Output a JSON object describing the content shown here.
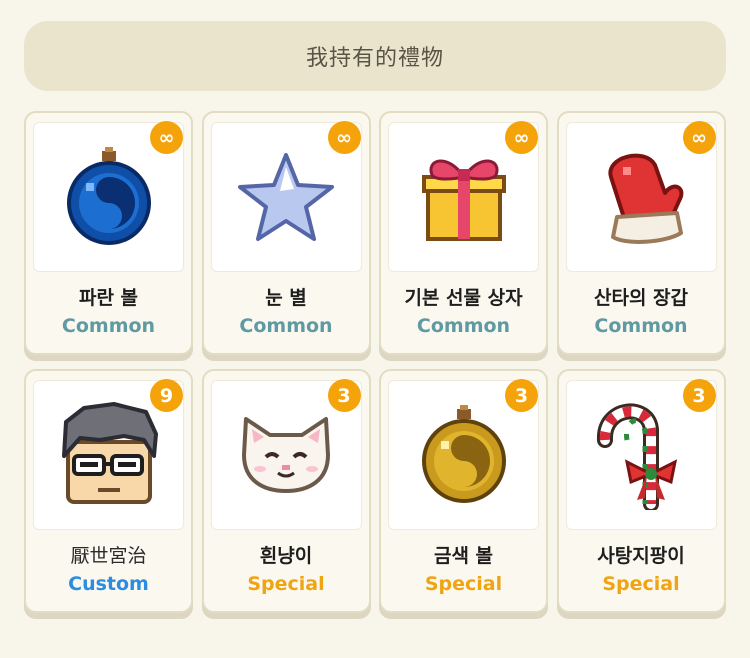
{
  "header": {
    "title": "我持有的禮物"
  },
  "colors": {
    "common": "#5f9aa3",
    "custom": "#2b8de0",
    "special": "#f0a412",
    "badge": "#f5a30a"
  },
  "items": [
    {
      "name": "파란 볼",
      "rarity": "Common",
      "rarity_class": "common",
      "count": "∞",
      "icon": "blue-ornament-icon"
    },
    {
      "name": "눈 별",
      "rarity": "Common",
      "rarity_class": "common",
      "count": "∞",
      "icon": "snow-star-icon"
    },
    {
      "name": "기본 선물 상자",
      "rarity": "Common",
      "rarity_class": "common",
      "count": "∞",
      "icon": "gift-box-icon"
    },
    {
      "name": "산타의 장갑",
      "rarity": "Common",
      "rarity_class": "common",
      "count": "∞",
      "icon": "santa-mitten-icon"
    },
    {
      "name": "厭世宮治",
      "rarity": "Custom",
      "rarity_class": "custom",
      "count": "9",
      "icon": "avatar-glasses-icon"
    },
    {
      "name": "흰냥이",
      "rarity": "Special",
      "rarity_class": "special",
      "count": "3",
      "icon": "white-cat-icon"
    },
    {
      "name": "금색 볼",
      "rarity": "Special",
      "rarity_class": "special",
      "count": "3",
      "icon": "gold-ornament-icon"
    },
    {
      "name": "사탕지팡이",
      "rarity": "Special",
      "rarity_class": "special",
      "count": "3",
      "icon": "candy-cane-icon"
    }
  ]
}
